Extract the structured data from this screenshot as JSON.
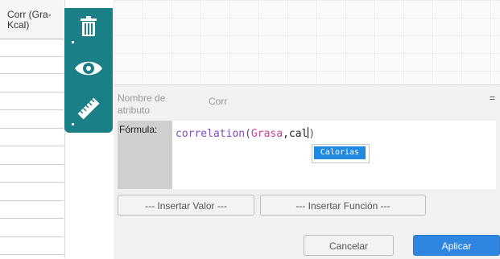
{
  "spreadsheet": {
    "column_header": "Corr (Gra-\nKcal)"
  },
  "toolbar": {
    "tools": [
      {
        "icon": "trash-icon"
      },
      {
        "icon": "eye-icon"
      },
      {
        "icon": "ruler-icon"
      }
    ],
    "color": "#1a7f86"
  },
  "dialog": {
    "name_label": "Nombre de atributo",
    "name_value": "Corr",
    "equals": "=",
    "formula_label": "Fórmula:",
    "formula": {
      "function": "correlation",
      "open_paren": "(",
      "field": "Grasa",
      "separator": ",",
      "typed": "cal",
      "close_paren": ")"
    },
    "autocomplete": {
      "selected": "Calorias"
    },
    "buttons": {
      "insert_value": "--- Insertar Valor ---",
      "insert_function": "--- Insertar Función ---",
      "cancel": "Cancelar",
      "apply": "Aplicar"
    },
    "colors": {
      "apply": "#2f86e0",
      "field_token": "#d43a99",
      "function_token": "#7c4dbb",
      "autocomplete_highlight": "#1f8ae0"
    }
  }
}
